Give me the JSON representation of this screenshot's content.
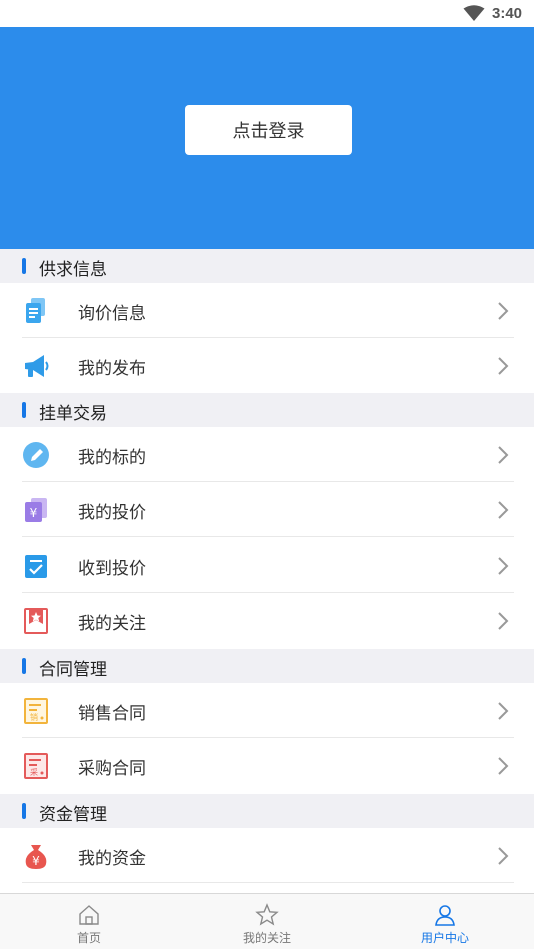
{
  "status_bar": {
    "time": "3:40"
  },
  "hero": {
    "login_label": "点击登录"
  },
  "sections": [
    {
      "title": "供求信息",
      "items": [
        {
          "label": "询价信息",
          "icon": "inquiry-doc-icon"
        },
        {
          "label": "我的发布",
          "icon": "megaphone-icon"
        }
      ]
    },
    {
      "title": "挂单交易",
      "items": [
        {
          "label": "我的标的",
          "icon": "pen-icon"
        },
        {
          "label": "我的投价",
          "icon": "yuan-card-icon"
        },
        {
          "label": "收到投价",
          "icon": "check-list-icon"
        },
        {
          "label": "我的关注",
          "icon": "star-bookmark-icon"
        }
      ]
    },
    {
      "title": "合同管理",
      "items": [
        {
          "label": "销售合同",
          "icon": "sales-contract-icon"
        },
        {
          "label": "采购合同",
          "icon": "purchase-contract-icon"
        }
      ]
    },
    {
      "title": "资金管理",
      "items": [
        {
          "label": "我的资金",
          "icon": "money-bag-icon"
        }
      ]
    }
  ],
  "tabs": [
    {
      "label": "首页",
      "icon": "home-icon",
      "active": false
    },
    {
      "label": "我的关注",
      "icon": "star-icon",
      "active": false
    },
    {
      "label": "用户中心",
      "icon": "user-icon",
      "active": true
    }
  ],
  "colors": {
    "accent": "#2c8ceb",
    "section_bar": "#1677e6",
    "tab_active": "#1677e6"
  }
}
